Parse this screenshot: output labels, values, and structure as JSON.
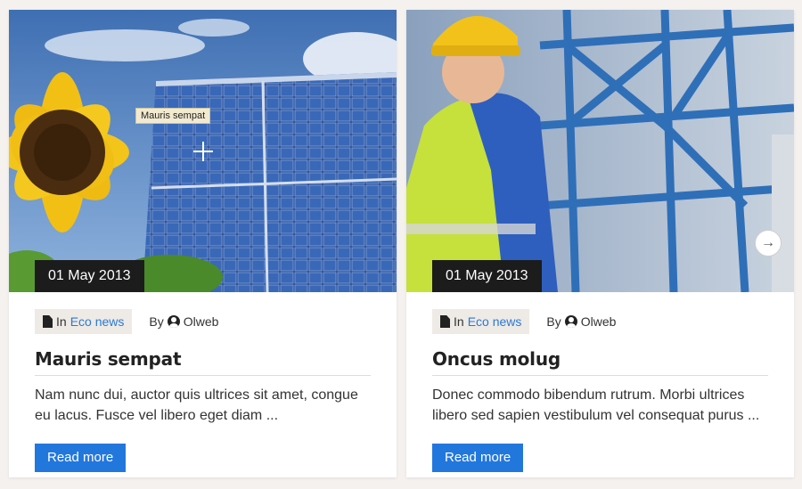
{
  "posts": [
    {
      "date": "01 May 2013",
      "category_prefix": "In",
      "category": "Eco news",
      "author_prefix": "By",
      "author": "Olweb",
      "title": "Mauris sempat",
      "excerpt": "Nam nunc dui, auctor quis ultrices sit amet, congue eu lacus. Fusce vel libero eget diam ...",
      "read_more": "Read more",
      "hover_label": "Mauris sempat"
    },
    {
      "date": "01 May 2013",
      "category_prefix": "In",
      "category": "Eco news",
      "author_prefix": "By",
      "author": "Olweb",
      "title": "Oncus molug",
      "excerpt": "Donec commodo bibendum rutrum. Morbi ultrices libero sed sapien vestibulum vel consequat purus ...",
      "read_more": "Read more"
    }
  ],
  "carousel": {
    "next_icon": "arrow-right-icon",
    "next_glyph": "→"
  },
  "colors": {
    "accent": "#2277dd",
    "link": "#2a7ad6",
    "badge": "#1c1c1c"
  }
}
